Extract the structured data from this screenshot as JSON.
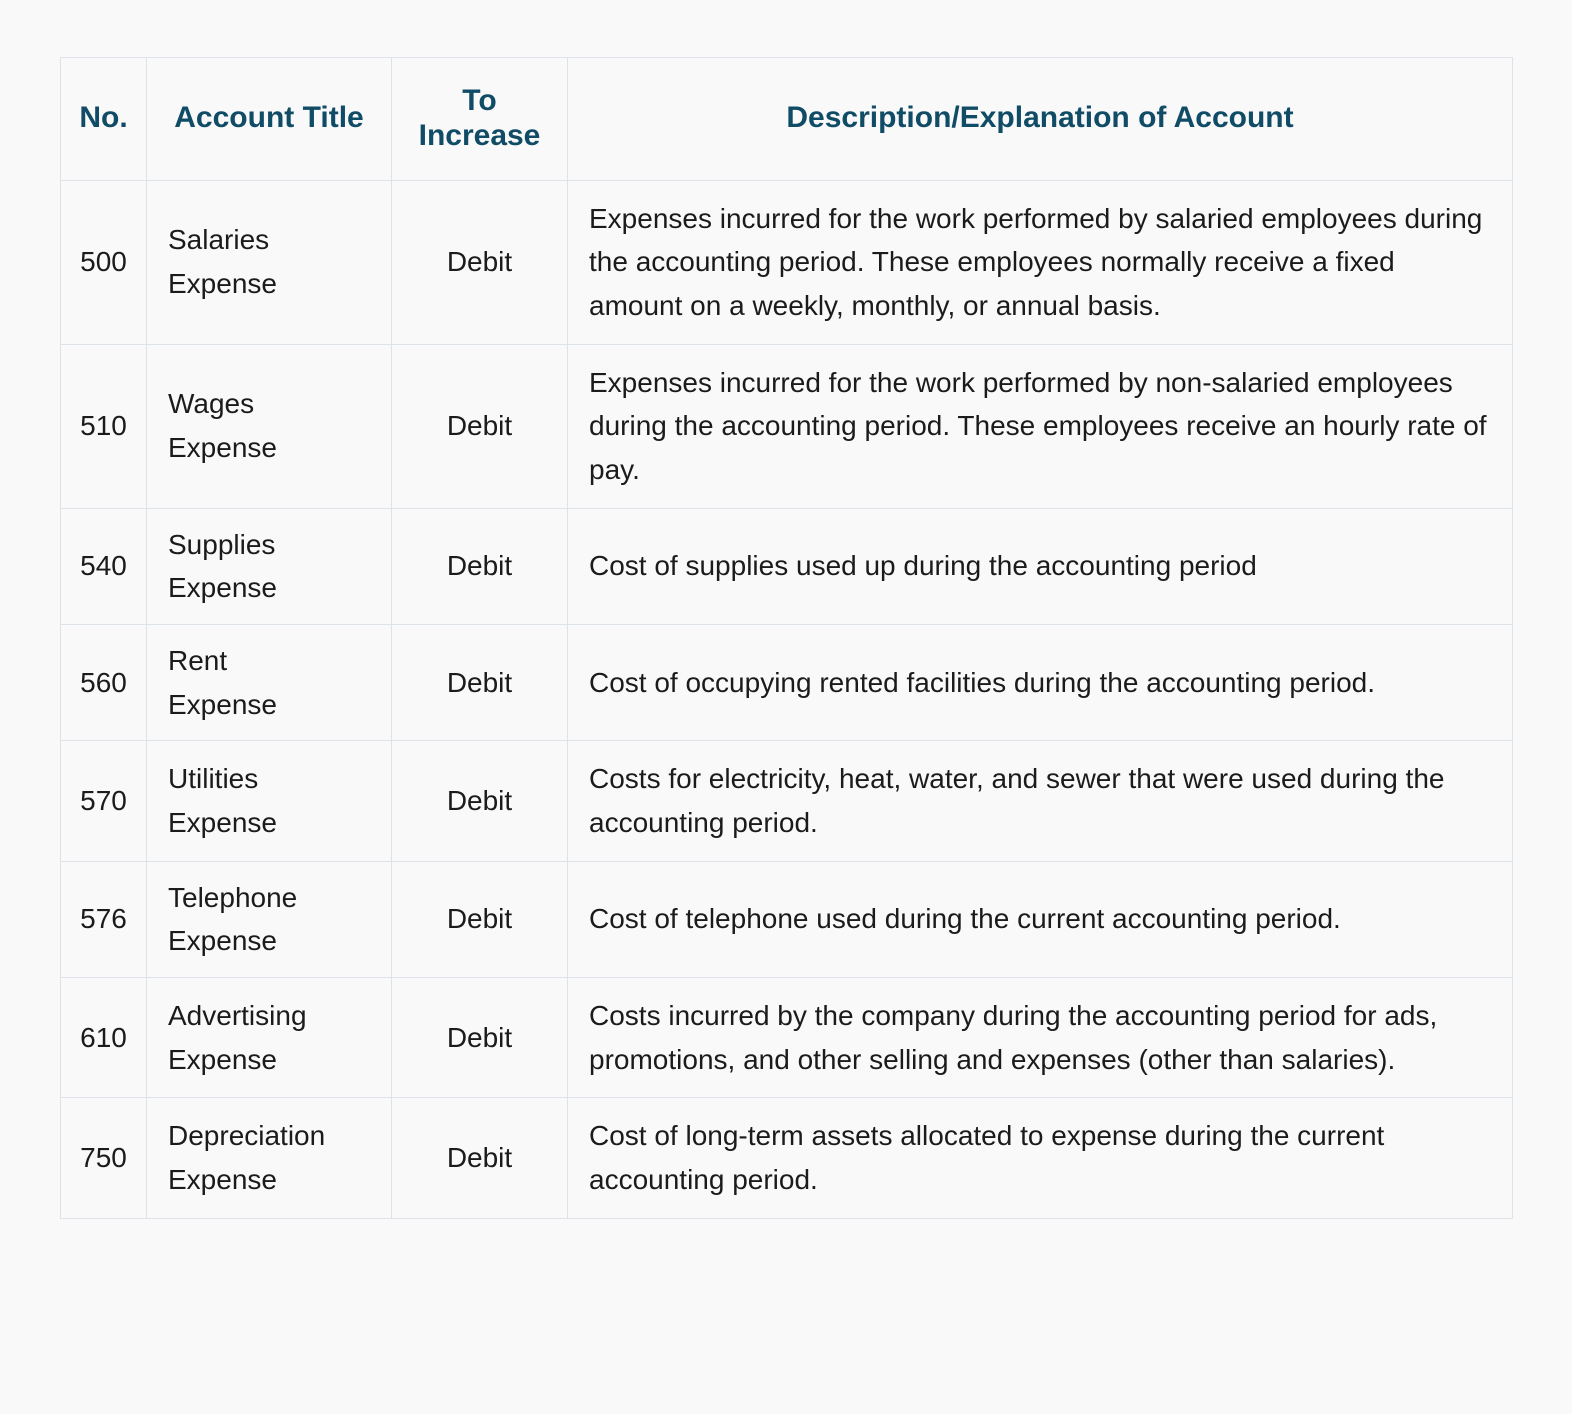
{
  "table": {
    "columns": [
      {
        "key": "no",
        "label": "No."
      },
      {
        "key": "title",
        "label": "Account Title"
      },
      {
        "key": "increase",
        "label": "To\nIncrease"
      },
      {
        "key": "description",
        "label": "Description/Explanation of Account"
      }
    ],
    "header": {
      "no": "No.",
      "title": "Account Title",
      "increase_line1": "To",
      "increase_line2": "Increase",
      "description": "Description/Explanation of Account"
    },
    "rows": [
      {
        "no": "500",
        "title": "Salaries Expense",
        "increase": "Debit",
        "description": "Expenses incurred for the work performed by salaried employees during the accounting period. These employees normally receive a fixed amount on a weekly, monthly, or annual basis."
      },
      {
        "no": "510",
        "title": "Wages Expense",
        "increase": "Debit",
        "description": "Expenses incurred for the work performed by non-salaried employees during the accounting period. These employees receive an hourly rate of pay."
      },
      {
        "no": "540",
        "title": "Supplies Expense",
        "increase": "Debit",
        "description": "Cost of supplies used up during the accounting period"
      },
      {
        "no": "560",
        "title": "Rent Expense",
        "increase": "Debit",
        "description": "Cost of occupying rented facilities during the accounting period."
      },
      {
        "no": "570",
        "title": "Utilities Expense",
        "increase": "Debit",
        "description": "Costs for electricity, heat, water, and sewer that were used during the accounting period."
      },
      {
        "no": "576",
        "title": "Telephone Expense",
        "increase": "Debit",
        "description": "Cost of telephone used during the current accounting period."
      },
      {
        "no": "610",
        "title": "Advertising Expense",
        "increase": "Debit",
        "description": "Costs incurred by the company during the accounting period for ads, promotions, and other selling and expenses (other than salaries)."
      },
      {
        "no": "750",
        "title": "Depreciation Expense",
        "increase": "Debit",
        "description": "Cost of long-term assets allocated to expense during the current accounting period."
      }
    ]
  },
  "colors": {
    "header_text": "#104c66",
    "body_text": "#1b1b1b",
    "border": "#dde3e8",
    "background": "#f9f9fa"
  }
}
